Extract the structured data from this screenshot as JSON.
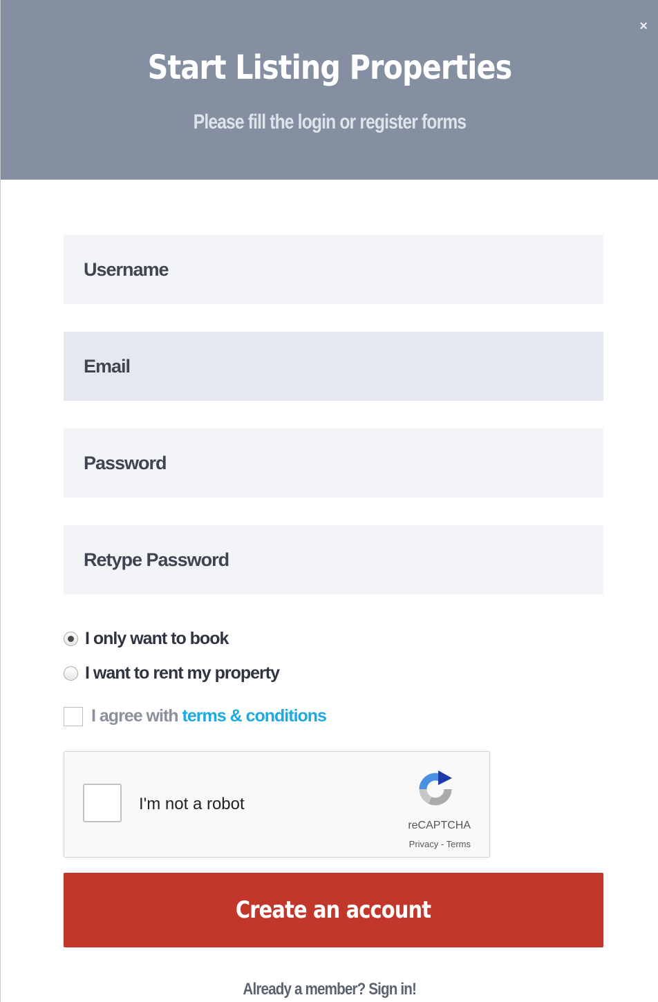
{
  "header": {
    "title": "Start Listing Properties",
    "subtitle": "Please fill the login or register forms",
    "close_label": "×",
    "background_color": "#858fa2"
  },
  "form": {
    "username_placeholder": "Username",
    "email_placeholder": "Email",
    "password_placeholder": "Password",
    "retype_password_placeholder": "Retype Password",
    "account_type_options": [
      {
        "label": "I only want to book",
        "selected": true
      },
      {
        "label": "I want to rent my property",
        "selected": false
      }
    ],
    "terms": {
      "prefix": "I agree with",
      "link_text": "terms & conditions",
      "checked": false
    }
  },
  "recaptcha": {
    "label": "I'm not a robot",
    "brand": "reCAPTCHA",
    "links": "Privacy - Terms",
    "icon": "recaptcha-logo-icon"
  },
  "submit": {
    "label": "Create an account",
    "color": "#c1372b"
  },
  "footer": {
    "signin_text": "Already a member? Sign in!"
  },
  "colors": {
    "link": "#1ea9e1",
    "field_background": "#f2f4f7"
  }
}
